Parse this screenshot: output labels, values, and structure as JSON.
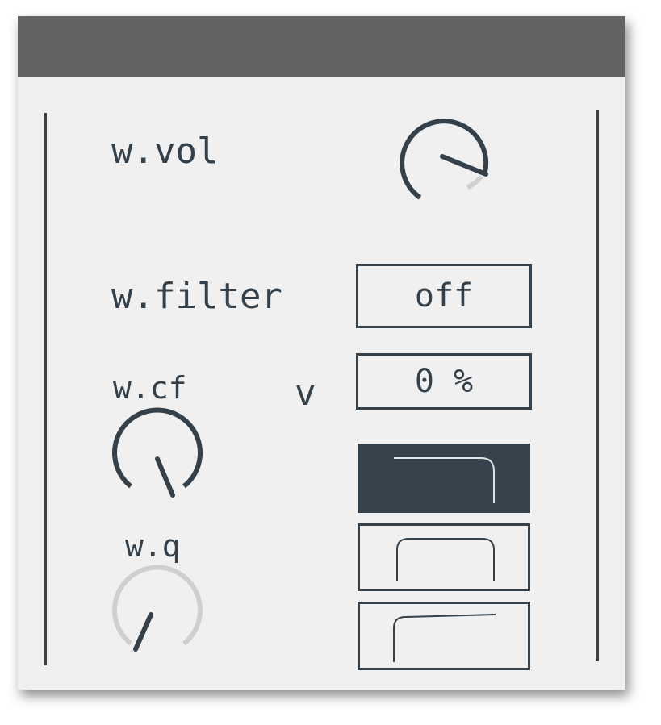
{
  "labels": {
    "vol": "w.vol",
    "filter": "w.filter",
    "cf": "w.cf",
    "q": "w.q",
    "v": "v"
  },
  "controls": {
    "filter_toggle": "off",
    "v_value": "0 %"
  },
  "knobs": {
    "vol": {
      "value": 1.0,
      "state": "active"
    },
    "cf": {
      "value": 0.5,
      "state": "active"
    },
    "q": {
      "value": 0.15,
      "state": "inactive"
    }
  },
  "filter_types": [
    {
      "icon": "lowpass-filter-icon",
      "selected": true
    },
    {
      "icon": "bandpass-filter-icon",
      "selected": false
    },
    {
      "icon": "highpass-filter-icon",
      "selected": false
    }
  ],
  "colors": {
    "ink": "#34404a",
    "title_bar": "#636363",
    "panel": "#f0f0f0",
    "inactive": "#cfcfcf"
  }
}
